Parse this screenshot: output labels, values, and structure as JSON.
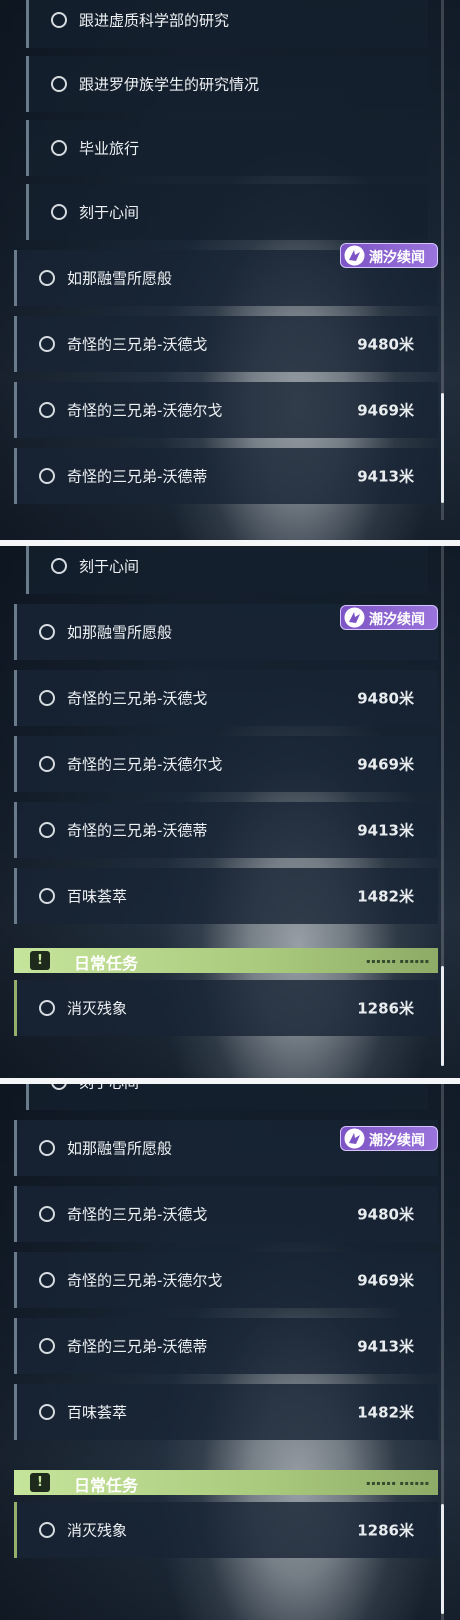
{
  "panels": [
    {
      "sub_quests": [
        "跟进虚质科学部的研究",
        "跟进罗伊族学生的研究情况",
        "毕业旅行",
        "刻于心间"
      ],
      "badge": "潮汐续闻",
      "main_quests": [
        {
          "label": "如那融雪所愿般",
          "distance": ""
        },
        {
          "label": "奇怪的三兄弟-沃德戈",
          "distance": "9480米"
        },
        {
          "label": "奇怪的三兄弟-沃德尔戈",
          "distance": "9469米"
        },
        {
          "label": "奇怪的三兄弟-沃德蒂",
          "distance": "9413米"
        }
      ]
    },
    {
      "sub_quests": [
        "刻于心间"
      ],
      "badge": "潮汐续闻",
      "main_quests": [
        {
          "label": "如那融雪所愿般",
          "distance": ""
        },
        {
          "label": "奇怪的三兄弟-沃德戈",
          "distance": "9480米"
        },
        {
          "label": "奇怪的三兄弟-沃德尔戈",
          "distance": "9469米"
        },
        {
          "label": "奇怪的三兄弟-沃德蒂",
          "distance": "9413米"
        },
        {
          "label": "百味荟萃",
          "distance": "1482米"
        }
      ],
      "daily_header": "日常任务",
      "daily_quests": [
        {
          "label": "消灭残象",
          "distance": "1286米"
        }
      ]
    },
    {
      "sub_quests": [
        "刻于心间"
      ],
      "badge": "潮汐续闻",
      "main_quests": [
        {
          "label": "如那融雪所愿般",
          "distance": ""
        },
        {
          "label": "奇怪的三兄弟-沃德戈",
          "distance": "9480米"
        },
        {
          "label": "奇怪的三兄弟-沃德尔戈",
          "distance": "9469米"
        },
        {
          "label": "奇怪的三兄弟-沃德蒂",
          "distance": "9413米"
        },
        {
          "label": "百味荟萃",
          "distance": "1482米"
        }
      ],
      "daily_header": "日常任务",
      "daily_quests": [
        {
          "label": "消灭残象",
          "distance": "1286米"
        }
      ]
    }
  ],
  "icons": {
    "quest_status": "circle-icon",
    "badge": "tidal-echo-icon",
    "daily": "exclamation-icon"
  },
  "colors": {
    "badge_purple": "#8a62d0",
    "daily_green": "#b8d98c",
    "row_bg": "#172433"
  }
}
